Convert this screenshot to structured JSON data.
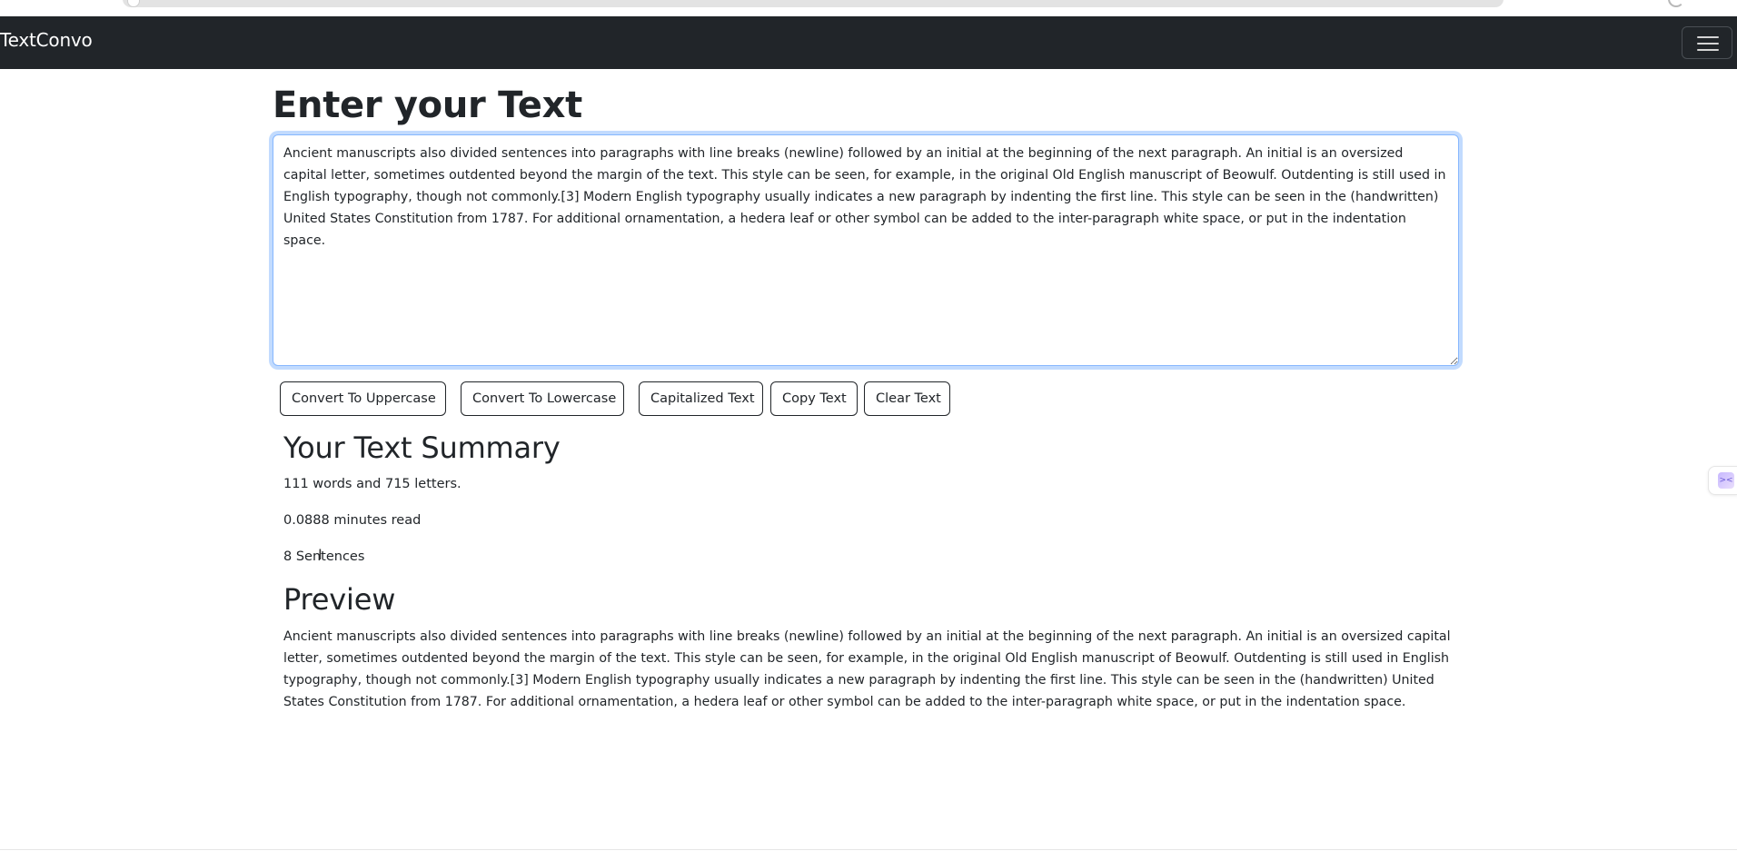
{
  "navbar": {
    "brand": "TextConvo",
    "toggler_icon": "hamburger-menu-icon"
  },
  "editor": {
    "heading": "Enter your Text",
    "text": "Ancient manuscripts also divided sentences into paragraphs with line breaks (newline) followed by an initial at the beginning of the next paragraph. An initial is an oversized capital letter, sometimes outdented beyond the margin of the text. This style can be seen, for example, in the original Old English manuscript of Beowulf. Outdenting is still used in English typography, though not commonly.[3] Modern English typography usually indicates a new paragraph by indenting the first line. This style can be seen in the (handwritten) United States Constitution from 1787. For additional ornamentation, a hedera leaf or other symbol can be added to the inter-paragraph white space, or put in the indentation space."
  },
  "buttons": {
    "uppercase": "Convert To Uppercase",
    "lowercase": "Convert To Lowercase",
    "capitalized": "Capitalized Text",
    "copy": "Copy Text",
    "clear": "Clear Text"
  },
  "summary": {
    "heading": "Your Text Summary",
    "words_letters": "111 words and 715 letters.",
    "read_time": "0.0888 minutes read",
    "sentences": "8 Sentences"
  },
  "preview": {
    "heading": "Preview",
    "text": "Ancient manuscripts also divided sentences into paragraphs with line breaks (newline) followed by an initial at the beginning of the next paragraph. An initial is an oversized capital letter, sometimes outdented beyond the margin of the text. This style can be seen, for example, in the original Old English manuscript of Beowulf. Outdenting is still used in English typography, though not commonly.[3] Modern English typography usually indicates a new paragraph by indenting the first line. This style can be seen in the (handwritten) United States Constitution from 1787. For additional ornamentation, a hedera leaf or other symbol can be added to the inter-paragraph white space, or put in the indentation space."
  },
  "colors": {
    "navbar_bg": "#212529",
    "focus_border": "#86b7fe",
    "text": "#212529"
  }
}
